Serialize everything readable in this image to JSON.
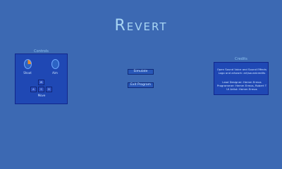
{
  "title": "Revert",
  "controls": {
    "caption": "Controls",
    "shoot_label": "Shoot",
    "aim_label": "Aim",
    "move_label": "Move",
    "keys": {
      "up": "W",
      "left": "A",
      "down": "S",
      "right": "D"
    }
  },
  "menu": {
    "simulate": "Simulate",
    "exit": "Exit Program"
  },
  "credits": {
    "caption": "Credits",
    "lines": [
      "Open Sound Voice and Sound Effects",
      "Logo and artwork: art/soundcredits",
      "",
      "Lead Designer: Hemm Ermos",
      "Programmer: Hemm Ermos, Robert T",
      "UI Artist: Hemm Ermos"
    ]
  },
  "colors": {
    "background": "#3c69b3",
    "panel": "#1f48b4",
    "title": "#a9d6f4"
  }
}
